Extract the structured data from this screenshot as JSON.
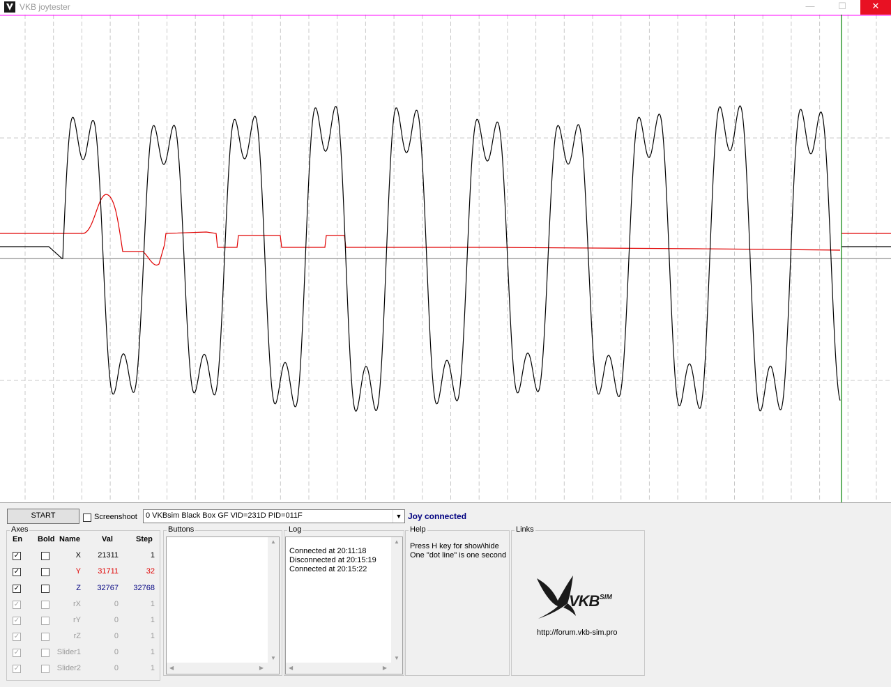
{
  "window": {
    "title": "VKB joytester",
    "minimize": "—",
    "maximize": "☐",
    "close": "✕"
  },
  "toolbar": {
    "start_label": "START",
    "screenshoot_label": "Screenshoot",
    "device": "0 VKBsim Black Box GF  VID=231D PID=011F",
    "status": "Joy connected",
    "status_color": "#000080"
  },
  "axes": {
    "title": "Axes",
    "headers": {
      "en": "En",
      "bold": "Bold",
      "name": "Name",
      "val": "Val",
      "step": "Step"
    },
    "rows": [
      {
        "name": "X",
        "val": "21311",
        "step": "1",
        "enabled": true,
        "active": true,
        "color": "#000000"
      },
      {
        "name": "Y",
        "val": "31711",
        "step": "32",
        "enabled": true,
        "active": true,
        "color": "#e00000"
      },
      {
        "name": "Z",
        "val": "32767",
        "step": "32768",
        "enabled": true,
        "active": true,
        "color": "#000080"
      },
      {
        "name": "rX",
        "val": "0",
        "step": "1",
        "enabled": true,
        "active": false,
        "color": "#9a9a9a"
      },
      {
        "name": "rY",
        "val": "0",
        "step": "1",
        "enabled": true,
        "active": false,
        "color": "#9a9a9a"
      },
      {
        "name": "rZ",
        "val": "0",
        "step": "1",
        "enabled": true,
        "active": false,
        "color": "#9a9a9a"
      },
      {
        "name": "Slider1",
        "val": "0",
        "step": "1",
        "enabled": true,
        "active": false,
        "color": "#9a9a9a"
      },
      {
        "name": "Slider2",
        "val": "0",
        "step": "1",
        "enabled": true,
        "active": false,
        "color": "#9a9a9a"
      }
    ]
  },
  "buttons_group": {
    "title": "Buttons"
  },
  "log": {
    "title": "Log",
    "lines": [
      "Connected at 20:11:18",
      "Disconnected at 20:15:19",
      "Connected at 20:15:22"
    ]
  },
  "help": {
    "title": "Help",
    "lines": [
      "Press H key for show\\hide",
      "One \"dot line\" is one second"
    ]
  },
  "links": {
    "title": "Links",
    "url": "http://forum.vkb-sim.pro",
    "logo_text": "VKB",
    "logo_sup": "SIM"
  },
  "plot": {
    "grid_color": "#c8c8c8",
    "top_line_color": "#ff00ff",
    "cursor_color": "#008000",
    "center_line_color": "#a0a0a0",
    "series": [
      {
        "color": "#000000"
      },
      {
        "color": "#e00000"
      }
    ]
  }
}
